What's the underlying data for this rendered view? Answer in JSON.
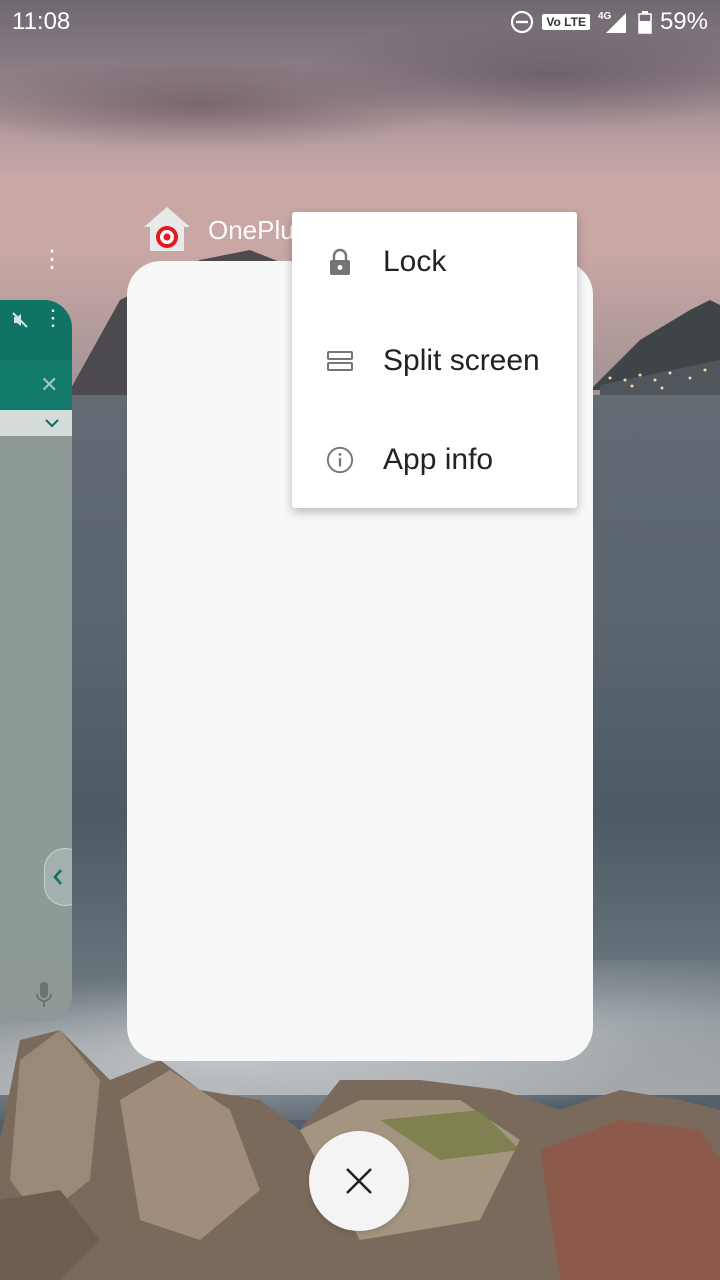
{
  "status_bar": {
    "time": "11:08",
    "dnd_icon": "minus-circle-icon",
    "volte": "Vo LTE",
    "network": "4G",
    "battery_percent": "59%"
  },
  "recent_app": {
    "name": "OnePlu",
    "icon": "home-target-icon"
  },
  "context_menu": {
    "items": [
      {
        "label": "Lock",
        "icon": "lock-icon"
      },
      {
        "label": "Split screen",
        "icon": "split-screen-icon"
      },
      {
        "label": "App info",
        "icon": "info-icon"
      }
    ]
  },
  "clear_all": {
    "icon": "close-icon"
  },
  "colors": {
    "menu_bg": "#ffffff",
    "card_bg": "#f8f8f8",
    "whatsapp_green": "#0f7465"
  }
}
